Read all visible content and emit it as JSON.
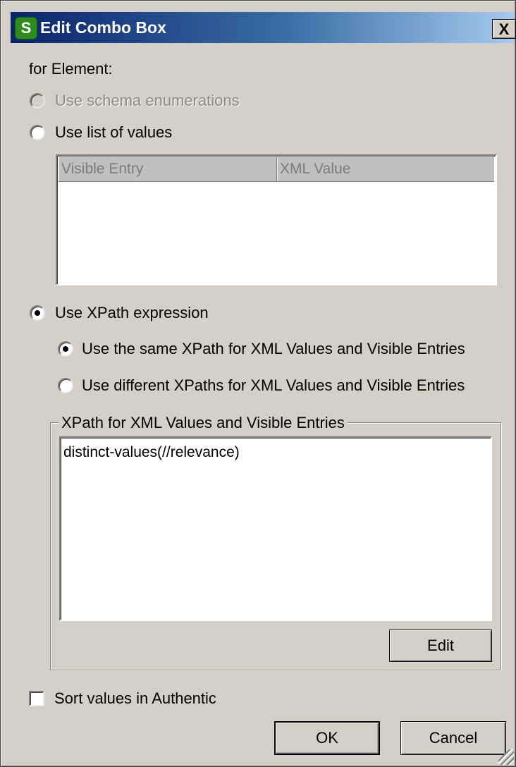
{
  "window": {
    "title": "Edit Combo Box",
    "close_label": "X",
    "app_icon": "altova-stylevision-icon"
  },
  "for_element_label": "for Element:",
  "options": {
    "schema_enumerations": {
      "label": "Use schema enumerations",
      "checked": false,
      "enabled": false
    },
    "list_of_values": {
      "label": "Use list of values",
      "checked": false,
      "enabled": true
    },
    "xpath_expression": {
      "label": "Use XPath expression",
      "checked": true,
      "enabled": true
    }
  },
  "list_table": {
    "columns": [
      "Visible Entry",
      "XML Value"
    ],
    "rows": []
  },
  "xpath_mode": {
    "same": {
      "label": "Use the same XPath for XML Values and Visible Entries",
      "checked": true
    },
    "different": {
      "label": "Use different XPaths for XML Values and Visible Entries",
      "checked": false
    }
  },
  "xpath_group": {
    "legend": "XPath for XML Values and Visible Entries",
    "expression": "distinct-values(//relevance)",
    "edit_label": "Edit"
  },
  "sort_checkbox": {
    "label": "Sort values in Authentic",
    "checked": false
  },
  "buttons": {
    "ok": "OK",
    "cancel": "Cancel"
  }
}
